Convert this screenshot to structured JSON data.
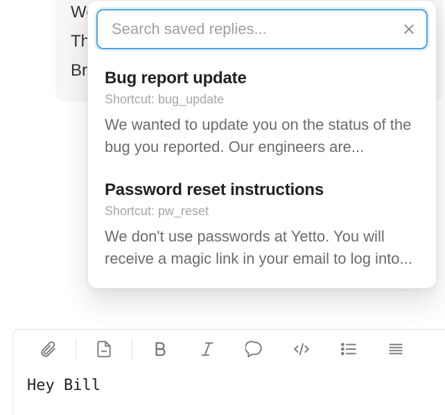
{
  "background_message": {
    "line1": "We'll have our engineering team take a look at t",
    "line2": "Th",
    "line3": "Br"
  },
  "search": {
    "placeholder": "Search saved replies...",
    "value": ""
  },
  "replies": [
    {
      "title": "Bug report update",
      "shortcut": "Shortcut: bug_update",
      "preview": "We wanted to update you on the status of the bug you reported. Our engineers are..."
    },
    {
      "title": "Password reset instructions",
      "shortcut": "Shortcut: pw_reset",
      "preview": "We don't use passwords at Yetto. You will receive a magic link in your email to log into..."
    }
  ],
  "composer": {
    "text": "Hey Bill"
  }
}
